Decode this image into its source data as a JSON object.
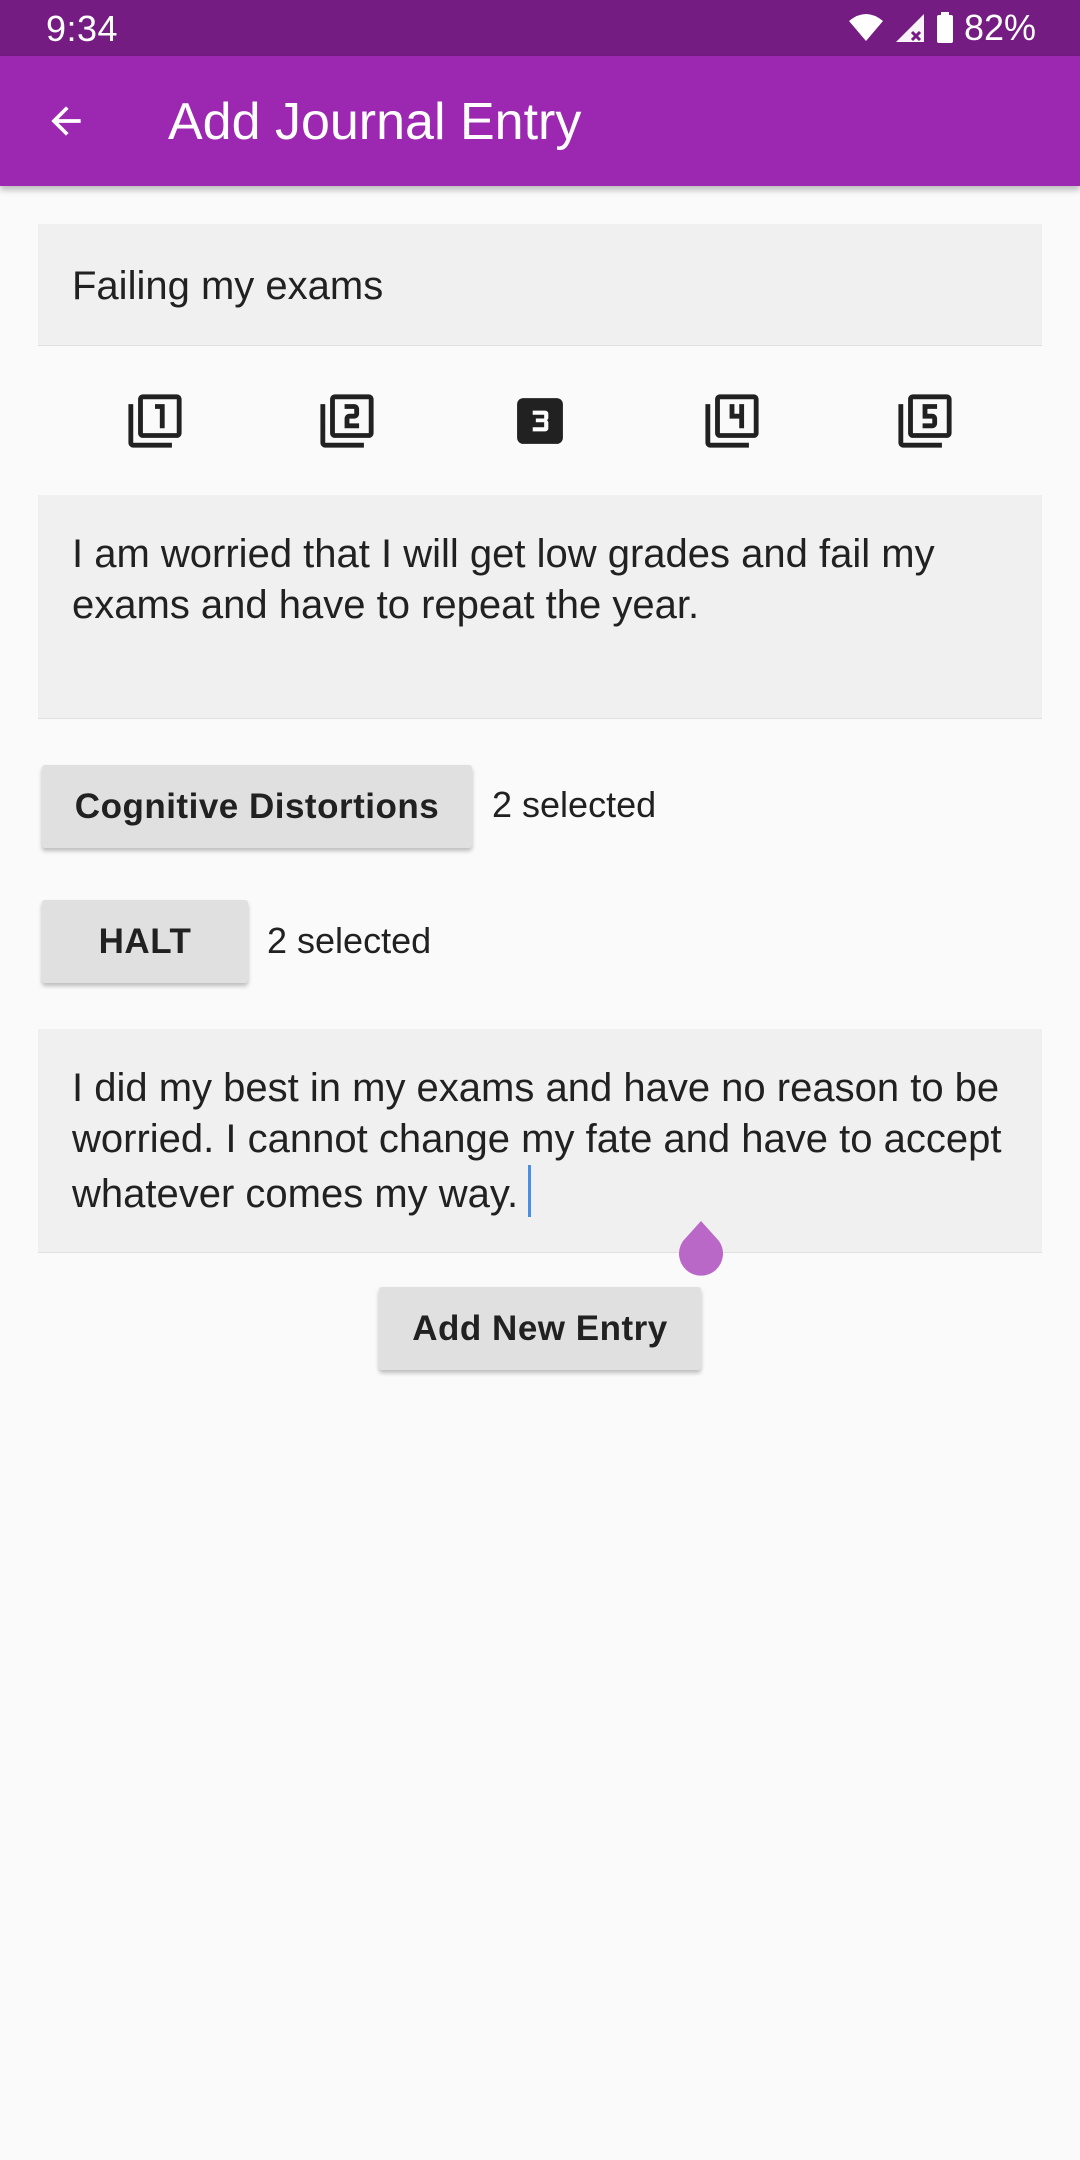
{
  "status_bar": {
    "time": "9:34",
    "battery": "82%",
    "icons": [
      "wifi-icon",
      "signal-icon",
      "battery-icon"
    ]
  },
  "app_bar": {
    "title": "Add Journal Entry",
    "back_icon": "arrow-back-icon",
    "color": "#9c27b0"
  },
  "form": {
    "title_value": "Failing my exams",
    "ratings": [
      {
        "label": "1",
        "selected": false
      },
      {
        "label": "2",
        "selected": false
      },
      {
        "label": "3",
        "selected": true
      },
      {
        "label": "4",
        "selected": false
      },
      {
        "label": "5",
        "selected": false
      }
    ],
    "description_value": "I am worried that I will get low grades and fail my exams and have to repeat the year.",
    "cognitive_distortions_label": "Cognitive Distortions",
    "cognitive_distortions_selected": "2 selected",
    "halt_label": "HALT",
    "halt_selected": "2 selected",
    "response_value": "I did my best in my exams and have no reason to be worried. I cannot change my fate and have to accept whatever comes my way.",
    "submit_label": "Add New Entry"
  },
  "colors": {
    "status_bar": "#751c82",
    "accent": "#9c27b0",
    "caret": "#4a90e2",
    "cursor_handle": "#ba68c8"
  }
}
